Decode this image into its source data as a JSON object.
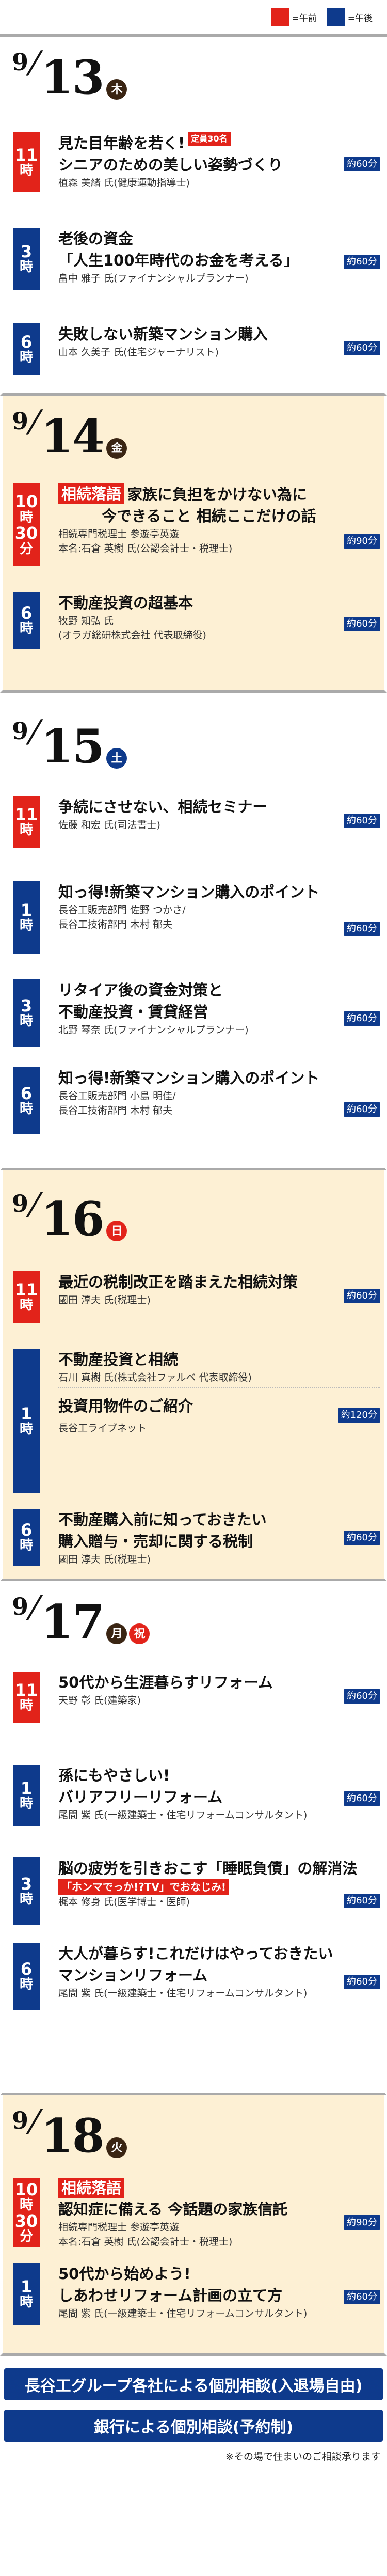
{
  "legend": {
    "am_label": "=午前",
    "pm_label": "=午後"
  },
  "colors": {
    "am": "#e2231a",
    "pm": "#0e3a8c",
    "cream": "#fdf0d4"
  },
  "days": [
    {
      "month": "9",
      "slash": "/",
      "day": "13",
      "weekday": "木",
      "sessions": [
        {
          "time": [
            "11",
            "時"
          ],
          "period": "am",
          "title": [
            "見た目年齢を若く!",
            "シニアのための美しい姿勢づくり"
          ],
          "note": "定員30名",
          "duration": "約60分",
          "speaker": [
            "植森 美緒 氏(健康運動指導士)"
          ]
        },
        {
          "time": [
            "3",
            "時"
          ],
          "period": "pm",
          "title": [
            "老後の資金",
            "「人生100年時代のお金を考える」"
          ],
          "duration": "約60分",
          "speaker": [
            "畠中 雅子 氏(ファイナンシャルプランナー)"
          ]
        },
        {
          "time": [
            "6",
            "時"
          ],
          "period": "pm",
          "title": [
            "失敗しない新築マンション購入"
          ],
          "duration": "約60分",
          "speaker": [
            "山本 久美子 氏(住宅ジャーナリスト)"
          ]
        }
      ]
    },
    {
      "month": "9",
      "slash": "/",
      "day": "14",
      "weekday": "金",
      "sessions": [
        {
          "time": [
            "10",
            "時",
            "30",
            "分"
          ],
          "period": "am",
          "tag": "相続落語",
          "title": [
            "家族に負担をかけない為に",
            "今できること 相続ここだけの話"
          ],
          "duration": "約90分",
          "speaker": [
            "相続専門税理士 参遊亭英遊",
            "本名:石倉 英樹 氏(公認会計士・税理士)"
          ]
        },
        {
          "time": [
            "6",
            "時"
          ],
          "period": "pm",
          "title": [
            "不動産投資の超基本"
          ],
          "duration": "約60分",
          "speaker": [
            "牧野 知弘 氏",
            "(オラガ総研株式会社 代表取締役)"
          ]
        }
      ]
    },
    {
      "month": "9",
      "slash": "/",
      "day": "15",
      "weekday": "土",
      "sessions": [
        {
          "time": [
            "11",
            "時"
          ],
          "period": "am",
          "title": [
            "争続にさせない、相続セミナー"
          ],
          "duration": "約60分",
          "speaker": [
            "佐藤 和宏 氏(司法書士)"
          ]
        },
        {
          "time": [
            "1",
            "時"
          ],
          "period": "pm",
          "title": [
            "知っ得!新築マンション購入のポイント"
          ],
          "duration": "約60分",
          "speaker": [
            "長谷工販売部門 佐野 つかさ/",
            "長谷工技術部門 木村 郁夫"
          ]
        },
        {
          "time": [
            "3",
            "時"
          ],
          "period": "pm",
          "title": [
            "リタイア後の資金対策と",
            "不動産投資・賃貸経営"
          ],
          "duration": "約60分",
          "speaker": [
            "北野 琴奈 氏(ファイナンシャルプランナー)"
          ]
        },
        {
          "time": [
            "6",
            "時"
          ],
          "period": "pm",
          "title": [
            "知っ得!新築マンション購入のポイント"
          ],
          "duration": "約60分",
          "speaker": [
            "長谷工販売部門 小島 明佳/",
            "長谷工技術部門 木村 郁夫"
          ]
        }
      ]
    },
    {
      "month": "9",
      "slash": "/",
      "day": "16",
      "weekday": "日",
      "sessions": [
        {
          "time": [
            "11",
            "時"
          ],
          "period": "am",
          "title": [
            "最近の税制改正を踏まえた相続対策"
          ],
          "duration": "約60分",
          "speaker": [
            "國田 淳夫 氏(税理士)"
          ]
        },
        {
          "time": [
            "1",
            "時"
          ],
          "period": "pm",
          "title": [
            "不動産投資と相続"
          ],
          "duration": "約120分",
          "speaker": [
            "石川 真樹 氏(株式会社ファルベ 代表取締役)"
          ],
          "title2": "投資用物件のご紹介",
          "speaker2": "長谷工ライブネット"
        },
        {
          "time": [
            "6",
            "時"
          ],
          "period": "pm",
          "title": [
            "不動産購入前に知っておきたい",
            "購入贈与・売却に関する税制"
          ],
          "duration": "約60分",
          "speaker": [
            "國田 淳夫 氏(税理士)"
          ]
        }
      ]
    },
    {
      "month": "9",
      "slash": "/",
      "day": "17",
      "weekday": "月",
      "weekday2": "祝",
      "sessions": [
        {
          "time": [
            "11",
            "時"
          ],
          "period": "am",
          "title": [
            "50代から生涯暮らすリフォーム"
          ],
          "duration": "約60分",
          "speaker": [
            "天野 彰 氏(建築家)"
          ]
        },
        {
          "time": [
            "1",
            "時"
          ],
          "period": "pm",
          "title": [
            "孫にもやさしい!",
            "バリアフリーリフォーム"
          ],
          "duration": "約60分",
          "speaker": [
            "尾間 紫 氏(一級建築士・住宅リフォームコンサルタント)"
          ]
        },
        {
          "time": [
            "3",
            "時"
          ],
          "period": "pm",
          "title": [
            "脳の疲労を引きおこす「睡眠負債」の解消法"
          ],
          "subtag": "「ホンマでっか!?TV」でおなじみ!",
          "duration": "約60分",
          "speaker": [
            "梶本 修身 氏(医学博士・医師)"
          ]
        },
        {
          "time": [
            "6",
            "時"
          ],
          "period": "pm",
          "title": [
            "大人が暮らす!これだけはやっておきたい",
            "マンションリフォーム"
          ],
          "duration": "約60分",
          "speaker": [
            "尾間 紫 氏(一級建築士・住宅リフォームコンサルタント)"
          ]
        }
      ]
    },
    {
      "month": "9",
      "slash": "/",
      "day": "18",
      "weekday": "火",
      "sessions": [
        {
          "time": [
            "10",
            "時",
            "30",
            "分"
          ],
          "period": "am",
          "tag": "相続落語",
          "title": [
            "",
            "認知症に備える 今話題の家族信託"
          ],
          "duration": "約90分",
          "speaker": [
            "相続専門税理士 参遊亭英遊",
            "本名:石倉 英樹 氏(公認会計士・税理士)"
          ]
        },
        {
          "time": [
            "1",
            "時"
          ],
          "period": "pm",
          "title": [
            "50代から始めよう!",
            "しあわせリフォーム計画の立て方"
          ],
          "duration": "約60分",
          "speaker": [
            "尾間 紫 氏(一級建築士・住宅リフォームコンサルタント)"
          ]
        }
      ]
    }
  ],
  "banners": [
    "長谷工グループ各社による個別相談(入退場自由)",
    "銀行による個別相談(予約制)"
  ],
  "footnote": "※その場で住まいのご相談承ります"
}
